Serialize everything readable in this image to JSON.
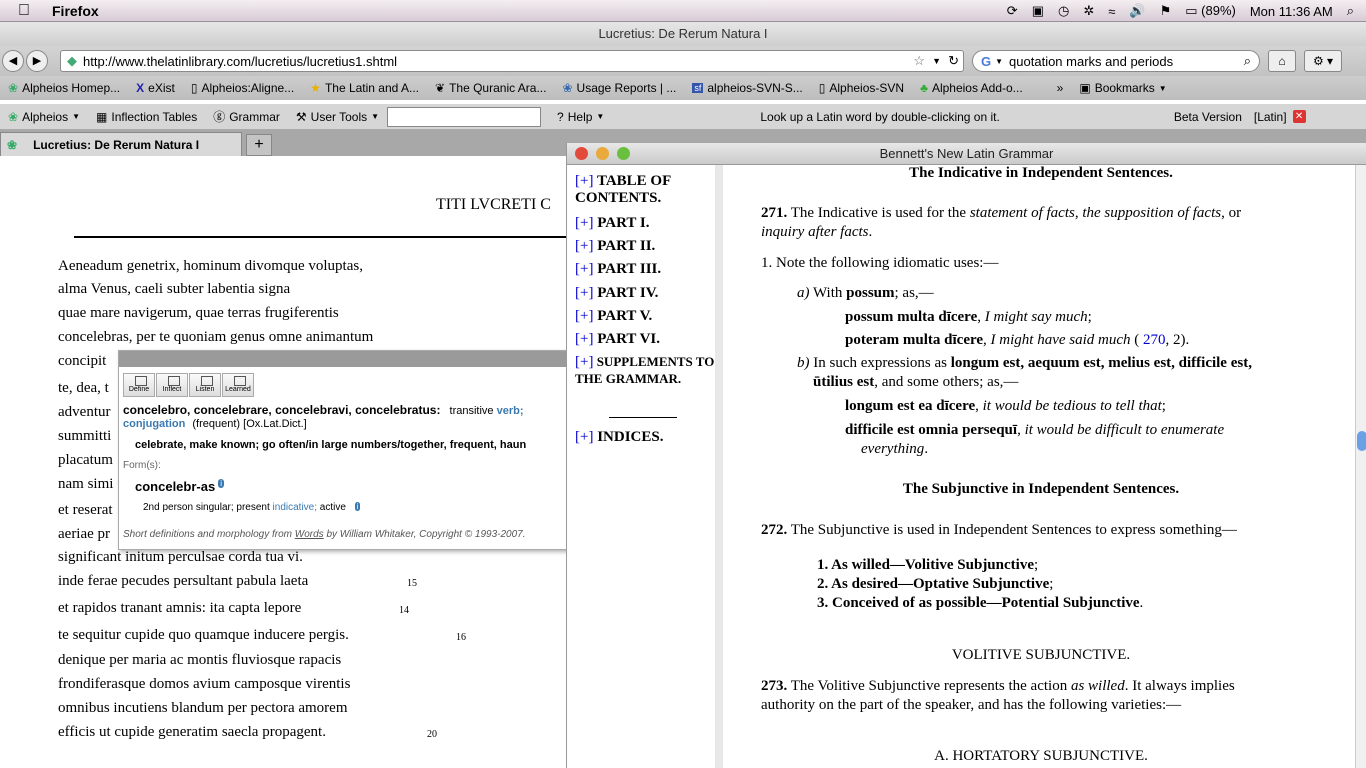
{
  "menubar": {
    "app": "Firefox",
    "battery": "(89%)",
    "clock": "Mon 11:36 AM"
  },
  "window": {
    "title": "Lucretius: De Rerum Natura I"
  },
  "nav": {
    "url": "http://www.thelatinlibrary.com/lucretius/lucretius1.shtml",
    "search": "quotation marks and periods"
  },
  "bookmarks": {
    "items": [
      "Alpheios Homep...",
      "eXist",
      "Alpheios:Aligne...",
      "The Latin and A...",
      "The Quranic Ara...",
      "Usage Reports | ...",
      "alpheios-SVN-S...",
      "Alpheios-SVN",
      "Alpheios Add-o..."
    ],
    "more": "»",
    "bookmarks_label": "Bookmarks"
  },
  "alpheios": {
    "menu": "Alpheios",
    "inflection": "Inflection Tables",
    "grammar": "Grammar",
    "tools": "User Tools",
    "help": "Help",
    "hint": "Look up a  Latin word by double-clicking on it.",
    "beta": "Beta Version",
    "lang": "[Latin]"
  },
  "tab": {
    "label": "Lucretius: De Rerum Natura I",
    "new": "+"
  },
  "page": {
    "heading": "TITI LVCRETI C",
    "lines": [
      "Aeneadum genetrix, hominum divomque voluptas,",
      "alma Venus, caeli subter labentia signa",
      "quae mare navigerum, quae terras frugiferentis",
      "concelebras, per te quoniam genus omne animantum",
      "concipit",
      "te, dea, t",
      "adventur",
      "summitti",
      "placatum",
      "nam simi",
      "et reserat",
      "aeriae pr",
      "significant initum perculsae corda tua vi.",
      "inde ferae pecudes persultant pabula laeta",
      "et rapidos tranant amnis: ita capta lepore",
      "te sequitur cupide quo quamque inducere pergis.",
      "denique per maria ac montis fluviosque rapacis",
      "frondiferasque domos avium camposque virentis",
      "omnibus incutiens blandum per pectora amorem",
      "efficis ut cupide generatim saecla propagent."
    ],
    "nums": [
      "15",
      "14",
      "16",
      "20"
    ]
  },
  "popup": {
    "buttons": [
      "Define",
      "Inflect",
      "Listen",
      "Learned"
    ],
    "lemma": "concelebro, concelebrare, concelebravi, concelebratus:",
    "pos": "transitive",
    "verb": "verb;",
    "conj": "conjugation",
    "freq": "(frequent)  [Ox.Lat.Dict.]",
    "meaning": "celebrate, make known; go often/in large numbers/together, frequent, haun",
    "forms": "Form(s):",
    "form": "concelebr-as",
    "morph_a": "2nd person  singular;  present",
    "morph_b": "indicative;",
    "morph_c": "active",
    "credit_a": "Short definitions and morphology from",
    "credit_words": "Words",
    "credit_b": "by William Whitaker, Copyright © 1993-2007."
  },
  "grammar": {
    "title": "Bennett's New Latin Grammar",
    "toc": [
      "TABLE OF CONTENTS.",
      "PART I.",
      "PART II.",
      "PART III.",
      "PART IV.",
      "PART V.",
      "PART VI.",
      "SUPPLEMENTS TO THE GRAMMAR.",
      "INDICES."
    ],
    "plus": "[+]",
    "h1": "The Indicative in Independent Sentences.",
    "s271_num": "271.",
    "s271_a": "The Indicative is used for the",
    "s271_b": "statement of facts",
    "s271_c": ", ",
    "s271_d": "the supposition of facts",
    "s271_e": ", or",
    "s271_f": "inquiry after facts",
    "s271_g": ".",
    "note1": "1. Note the following idiomatic uses:—",
    "a_lbl": "a)",
    "a_text": "With",
    "a_bold": "possum",
    "a_tail": "; as,—",
    "ex1_b": "possum multa dīcere",
    "ex1_i": "I might say much",
    "ex2_b": "poteram multa dīcere",
    "ex2_i": "I might have said much",
    "ex2_ref": "270",
    "ex2_tail": ", 2).",
    "b_lbl": "b)",
    "b_text": "In such expressions as",
    "b_bold": "longum est, aequum est, melius est, difficile est,",
    "b_bold2": "ūtilius est",
    "b_tail": ", and some others; as,—",
    "ex3_b": "longum est ea dīcere",
    "ex3_i": "it would be tedious to tell that",
    "ex4_b": "difficile est omnia persequī",
    "ex4_i": "it would be difficult to enumerate",
    "ex4_i2": "everything",
    "h2": "The Subjunctive in Independent Sentences.",
    "s272_num": "272.",
    "s272": "The Subjunctive is used in Independent Sentences to express something—",
    "list": [
      "1. As willed—Volitive Subjunctive",
      "2. As desired—Optative Subjunctive",
      "3. Conceived of as possible—Potential Subjunctive"
    ],
    "h3": "VOLITIVE SUBJUNCTIVE.",
    "s273_num": "273.",
    "s273_a": "The Volitive Subjunctive represents the action",
    "s273_b": "as willed",
    "s273_c": ". It always implies",
    "s273_d": "authority on the part of the speaker, and has the following varieties:—",
    "h4": "A. HORTATORY SUBJUNCTIVE."
  }
}
